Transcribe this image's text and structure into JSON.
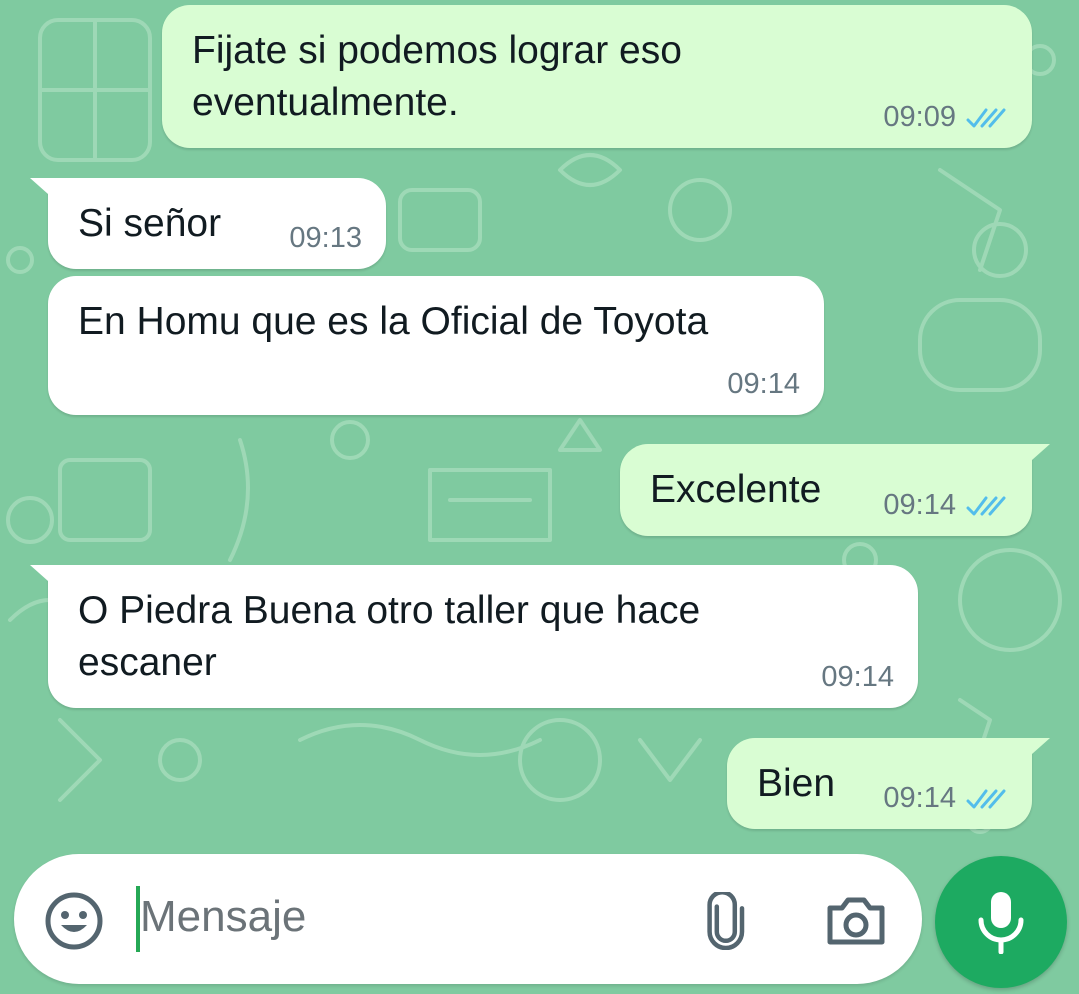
{
  "chat": {
    "messages": [
      {
        "direction": "outgoing",
        "text": "Fijate si podemos lograr eso\neventualmente.",
        "time": "09:09",
        "status": "read"
      },
      {
        "direction": "incoming",
        "text": "Si señor",
        "time": "09:13"
      },
      {
        "direction": "incoming",
        "text": "En Homu que es la Oficial de Toyota",
        "time": "09:14"
      },
      {
        "direction": "outgoing",
        "text": "Excelente",
        "time": "09:14",
        "status": "read"
      },
      {
        "direction": "incoming",
        "text": "O Piedra Buena otro taller que hace\nescaner",
        "time": "09:14"
      },
      {
        "direction": "outgoing",
        "text": "Bien",
        "time": "09:14",
        "status": "read"
      }
    ]
  },
  "composer": {
    "placeholder": "Mensaje",
    "icons": {
      "emoji": "smiley-icon",
      "attach": "paperclip-icon",
      "camera": "camera-icon",
      "mic": "microphone-icon"
    }
  },
  "colors": {
    "wallpaper": "#7fcaa0",
    "incoming_bubble": "#ffffff",
    "outgoing_bubble": "#d9fdd3",
    "read_ticks": "#53bdeb",
    "mic_button": "#1daa61"
  }
}
